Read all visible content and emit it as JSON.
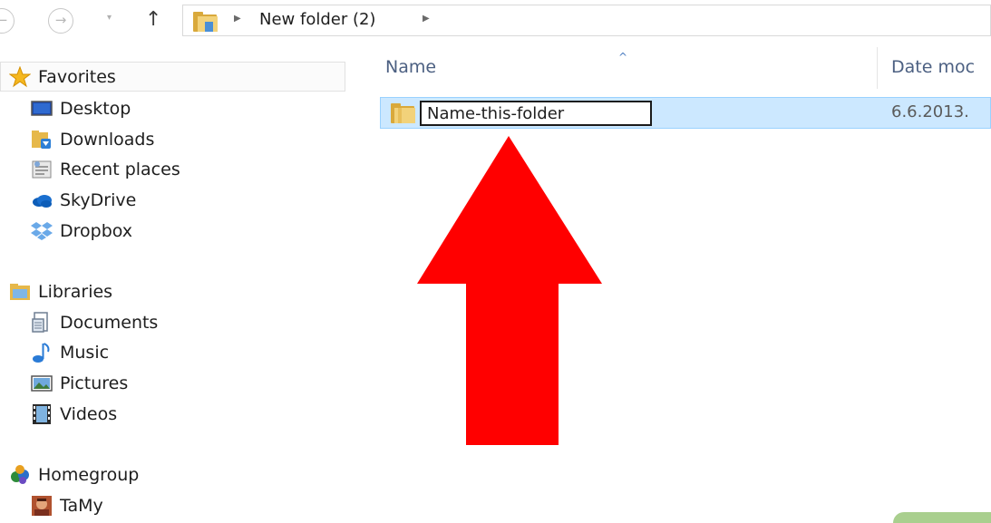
{
  "address_bar": {
    "back_glyph": "←",
    "forward_glyph": "→",
    "recent_glyph": "▾",
    "up_glyph": "↑",
    "breadcrumb_separator": "▶",
    "breadcrumb": "New folder (2)"
  },
  "navigation": {
    "favorites": {
      "label": "Favorites",
      "items": [
        {
          "label": "Desktop",
          "icon": "desktop-icon"
        },
        {
          "label": "Downloads",
          "icon": "downloads-icon"
        },
        {
          "label": "Recent places",
          "icon": "recent-places-icon"
        },
        {
          "label": "SkyDrive",
          "icon": "skydrive-icon"
        },
        {
          "label": "Dropbox",
          "icon": "dropbox-icon"
        }
      ]
    },
    "libraries": {
      "label": "Libraries",
      "items": [
        {
          "label": "Documents",
          "icon": "documents-icon"
        },
        {
          "label": "Music",
          "icon": "music-icon"
        },
        {
          "label": "Pictures",
          "icon": "pictures-icon"
        },
        {
          "label": "Videos",
          "icon": "videos-icon"
        }
      ]
    },
    "homegroup": {
      "label": "Homegroup",
      "items": [
        {
          "label": "TaMy",
          "icon": "user-avatar-icon"
        }
      ]
    }
  },
  "file_list": {
    "columns": {
      "name": "Name",
      "date": "Date moc",
      "sort_indicator": "^"
    },
    "rows": [
      {
        "name": "Name-this-folder",
        "date": "6.6.2013.",
        "selected": true,
        "renaming": true
      }
    ]
  },
  "colors": {
    "selection_bg": "#cce8ff",
    "selection_border": "#99d1ff",
    "arrow": "#ff0000",
    "folder": "#e9c15a"
  }
}
